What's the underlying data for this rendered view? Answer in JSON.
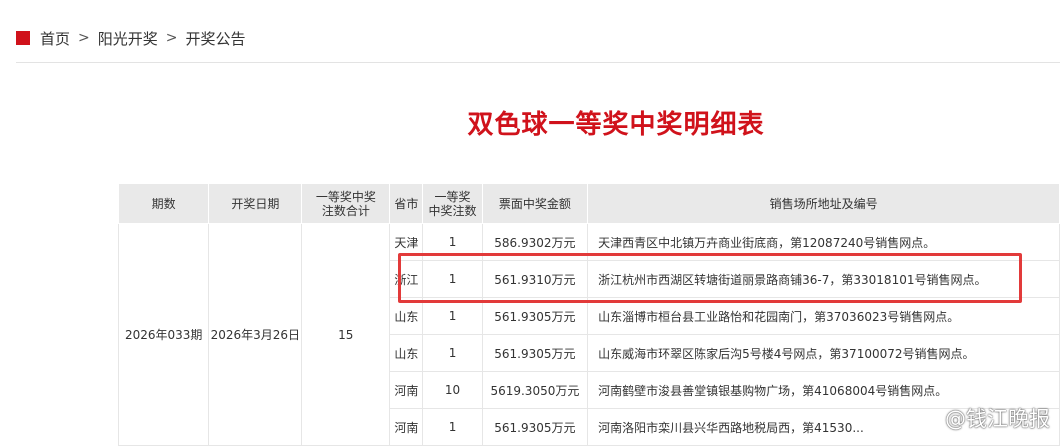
{
  "breadcrumb": {
    "home": "首页",
    "sep1": ">",
    "section": "阳光开奖",
    "sep2": ">",
    "page": "开奖公告"
  },
  "page_title": "双色球一等奖中奖明细表",
  "table": {
    "headers": {
      "issue": "期数",
      "draw_date": "开奖日期",
      "total_wins_1": "一等奖中奖",
      "total_wins_2": "注数合计",
      "province": "省市",
      "wins_1": "一等奖",
      "wins_2": "中奖注数",
      "amount": "票面中奖金额",
      "location": "销售场所地址及编号"
    },
    "issue": "2026年033期",
    "draw_date": "2026年3月26日",
    "total_wins": "15",
    "rows": [
      {
        "province": "天津",
        "wins": "1",
        "amount": "586.9302万元",
        "location": "天津西青区中北镇万卉商业街底商，第12087240号销售网点。"
      },
      {
        "province": "浙江",
        "wins": "1",
        "amount": "561.9310万元",
        "location": "浙江杭州市西湖区转塘街道丽景路商铺36-7，第33018101号销售网点。"
      },
      {
        "province": "山东",
        "wins": "1",
        "amount": "561.9305万元",
        "location": "山东淄博市桓台县工业路怡和花园南门，第37036023号销售网点。"
      },
      {
        "province": "山东",
        "wins": "1",
        "amount": "561.9305万元",
        "location": "山东威海市环翠区陈家后沟5号楼4号网点，第37100072号销售网点。"
      },
      {
        "province": "河南",
        "wins": "10",
        "amount": "5619.3050万元",
        "location": "河南鹤壁市浚县善堂镇银基购物广场，第41068004号销售网点。"
      },
      {
        "province": "河南",
        "wins": "1",
        "amount": "561.9305万元",
        "location": "河南洛阳市栾川县兴华西路地税局西，第41530..."
      }
    ]
  },
  "watermark": "@钱江晚报"
}
